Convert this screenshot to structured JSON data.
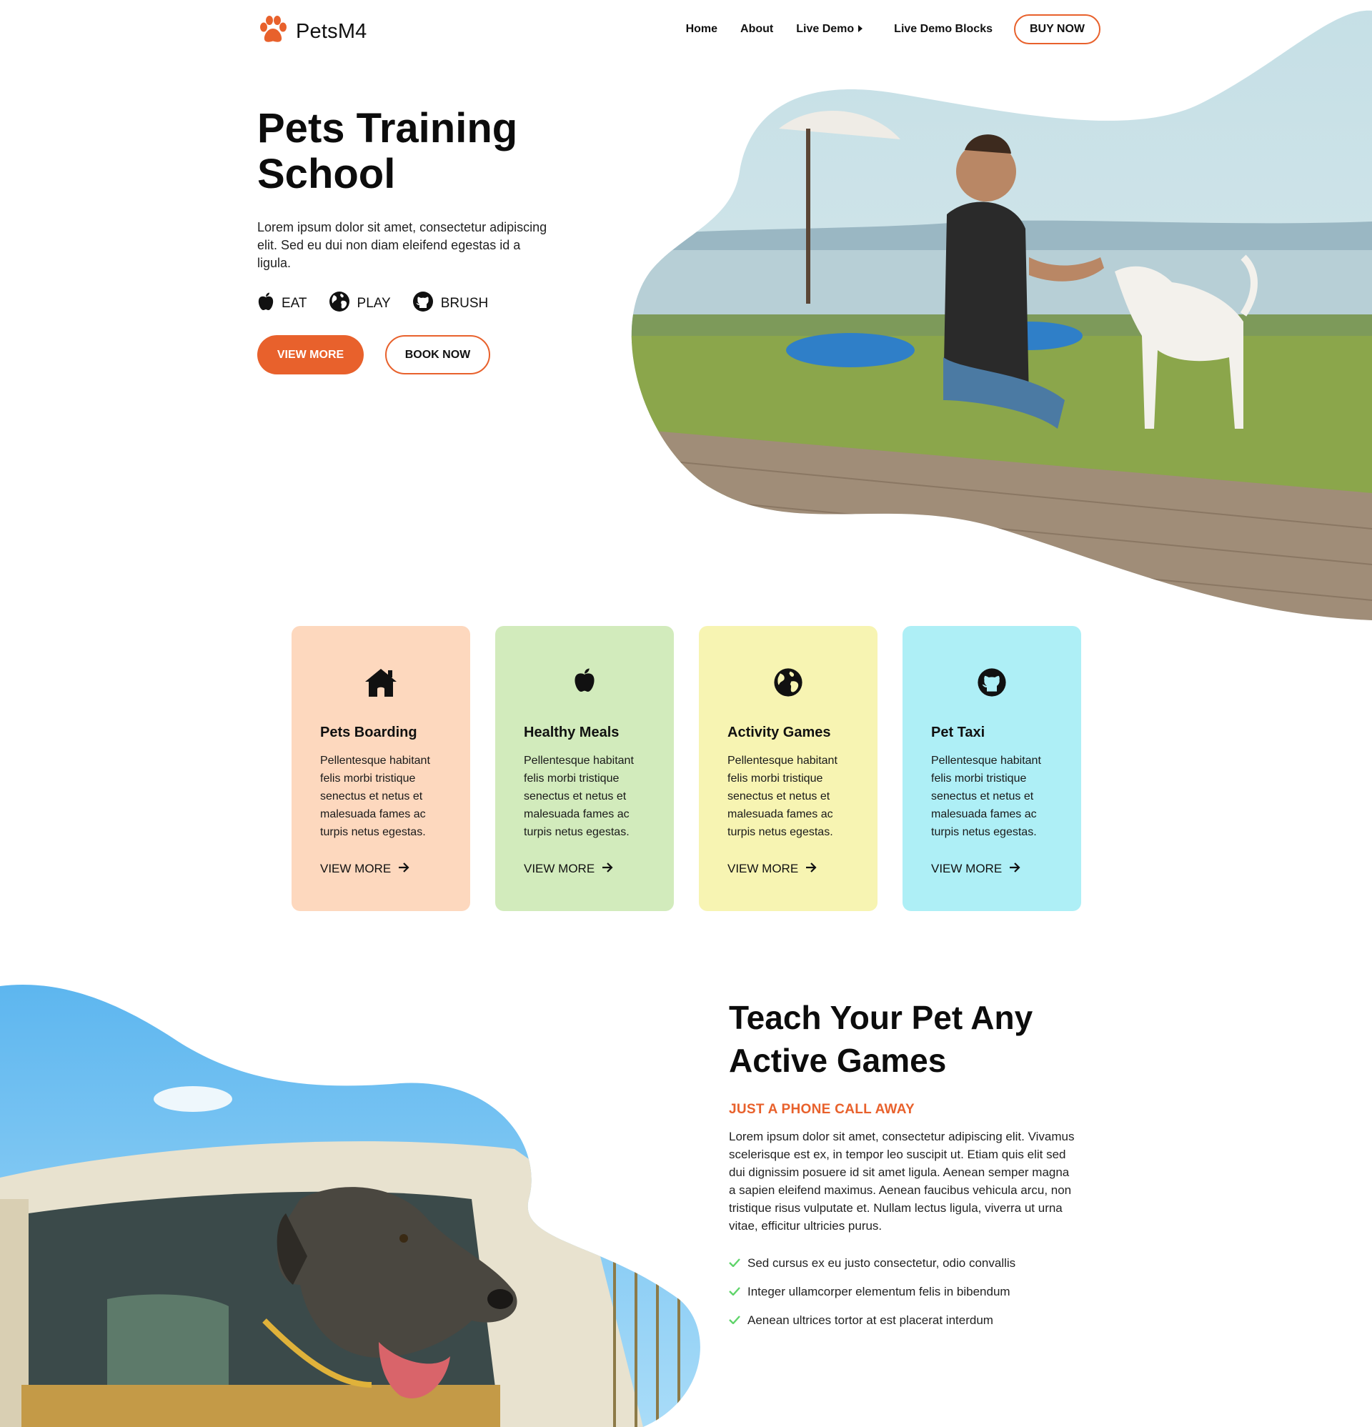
{
  "colors": {
    "accent": "#e8612c",
    "card_peach": "#fdd8be",
    "card_green": "#d2ebbc",
    "card_yellow": "#f7f4b2",
    "card_cyan": "#aeeff6"
  },
  "brand": {
    "name": "PetsM4",
    "logo_icon": "paw-icon"
  },
  "nav": {
    "items": [
      "Home",
      "About",
      "Live Demo",
      "Live Demo Blocks"
    ],
    "buy_label": "BUY NOW"
  },
  "hero": {
    "title_line1": "Pets Training",
    "title_line2": "School",
    "description": "Lorem ipsum dolor sit amet, consectetur adipiscing elit. Sed eu dui non diam eleifend egestas id a ligula.",
    "features": [
      {
        "label": "EAT",
        "icon": "apple-icon"
      },
      {
        "label": "PLAY",
        "icon": "globe-icon"
      },
      {
        "label": "BRUSH",
        "icon": "github-icon"
      }
    ],
    "primary_button": "VIEW MORE",
    "secondary_button": "BOOK NOW"
  },
  "cards": [
    {
      "icon": "home-icon",
      "title": "Pets Boarding",
      "description": "Pellentesque habitant felis morbi tristique senectus et netus et malesuada fames ac turpis netus egestas.",
      "link": "VIEW MORE"
    },
    {
      "icon": "apple-icon",
      "title": "Healthy Meals",
      "description": "Pellentesque habitant felis morbi tristique senectus et netus et malesuada fames ac turpis netus egestas.",
      "link": "VIEW MORE"
    },
    {
      "icon": "globe-icon",
      "title": "Activity Games",
      "description": "Pellentesque habitant felis morbi tristique senectus et netus et malesuada fames ac turpis netus egestas.",
      "link": "VIEW MORE"
    },
    {
      "icon": "github-icon",
      "title": "Pet Taxi",
      "description": "Pellentesque habitant felis morbi tristique senectus et netus et malesuada fames ac turpis netus egestas.",
      "link": "VIEW MORE"
    }
  ],
  "games": {
    "title_line1": "Teach Your Pet Any",
    "title_line2": "Active Games",
    "subtitle": "JUST A PHONE CALL AWAY",
    "description": "Lorem ipsum dolor sit amet, consectetur adipiscing elit. Vivamus scelerisque est ex, in tempor leo suscipit ut. Etiam quis elit sed dui dignissim posuere id sit amet ligula. Aenean semper magna a sapien eleifend maximus. Aenean faucibus vehicula arcu, non tristique risus vulputate et. Nullam lectus ligula, viverra ut urna vitae, efficitur ultricies purus.",
    "checklist": [
      "Sed cursus ex eu justo consectetur, odio convallis",
      "Integer ullamcorper elementum felis in bibendum",
      "Aenean ultrices tortor at est placerat interdum"
    ]
  }
}
